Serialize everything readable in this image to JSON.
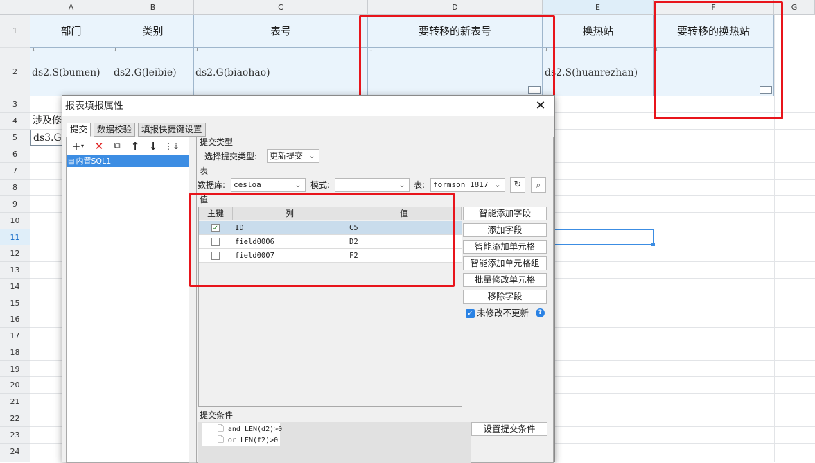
{
  "sheet": {
    "columns": [
      "A",
      "B",
      "C",
      "D",
      "E",
      "F",
      "G"
    ],
    "rows": [
      "1",
      "2",
      "3",
      "4",
      "5",
      "6",
      "7",
      "8",
      "9",
      "10",
      "11",
      "12",
      "13",
      "14",
      "15",
      "16",
      "17",
      "18",
      "19",
      "20",
      "21",
      "22",
      "23",
      "24"
    ],
    "header_cells": [
      "部门",
      "类别",
      "表号",
      "要转移的新表号",
      "换热站",
      "要转移的换热站"
    ],
    "data_cells": [
      "ds2.S(bumen)",
      "ds2.G(leibie)",
      "ds2.G(biaohao)",
      "",
      "ds2.S(huanrezhan)",
      ""
    ],
    "a4_text": "涉及修",
    "a5_text": "ds3.G"
  },
  "dialog": {
    "title": "报表填报属性",
    "close": "✕",
    "tabs": [
      "提交",
      "数据校验",
      "填报快捷键设置"
    ],
    "tree_item": "内置SQL1",
    "submit_type_label": "提交类型",
    "select_submit_type_label": "选择提交类型:",
    "submit_type_value": "更新提交",
    "table_section_label": "表",
    "database_label": "数据库:",
    "database_value": "cesloa",
    "mode_label": "模式:",
    "mode_value": "",
    "table_label": "表:",
    "table_value": "formson_1817",
    "value_section_label": "值",
    "grid_headers": [
      "主键",
      "列",
      "值"
    ],
    "grid_rows": [
      {
        "key": true,
        "column": "ID",
        "value": "C5"
      },
      {
        "key": false,
        "column": "field0006",
        "value": "D2"
      },
      {
        "key": false,
        "column": "field0007",
        "value": "F2"
      }
    ],
    "side_buttons": [
      "智能添加字段",
      "添加字段",
      "智能添加单元格",
      "智能添加单元格组",
      "批量修改单元格",
      "移除字段"
    ],
    "no_update_label": "未修改不更新",
    "condition_label": "提交条件",
    "conditions": [
      "and LEN(d2)>0",
      "or  LEN(f2)>0"
    ],
    "set_condition_button": "设置提交条件"
  },
  "colors": {
    "highlight_red": "#e8141b",
    "header_fill": "#eaf4fc",
    "selection_blue": "#3c8de3"
  }
}
